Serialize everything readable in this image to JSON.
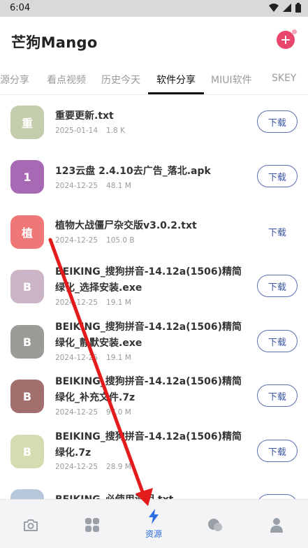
{
  "status": {
    "time": "6:04"
  },
  "app": {
    "title": "芒狗Mango"
  },
  "tabs": [
    {
      "label": "资源分享"
    },
    {
      "label": "看点视频"
    },
    {
      "label": "历史今天"
    },
    {
      "label": "软件分享"
    },
    {
      "label": "MIUI软件"
    },
    {
      "label": "SKEY"
    }
  ],
  "files": [
    {
      "avatar": "重",
      "color": "#c4ccae",
      "name": "重要更新.txt",
      "date": "2025-01-14",
      "size": "1.8 K",
      "button": "下载"
    },
    {
      "avatar": "1",
      "color": "#a769b3",
      "name": "123云盘 2.4.10去广告_落北.apk",
      "date": "2024-12-25",
      "size": "48.1 M",
      "button": "下载"
    },
    {
      "avatar": "植",
      "color": "#f07777",
      "name": "植物大战僵尸杂交版v3.0.2.txt",
      "date": "2024-12-25",
      "size": "105.0 B",
      "button": "下载"
    },
    {
      "avatar": "B",
      "color": "#cbb4c6",
      "name": "BEIKING_搜狗拼音-14.12a(1506)精简绿化_选择安装.exe",
      "date": "2024-12-25",
      "size": "19.1 M",
      "button": "下载"
    },
    {
      "avatar": "B",
      "color": "#9a9b96",
      "name": "BEIKING_搜狗拼音-14.12a(1506)精简绿化_静默安装.exe",
      "date": "2024-12-25",
      "size": "19.1 M",
      "button": "下载"
    },
    {
      "avatar": "B",
      "color": "#a26f6e",
      "name": "BEIKING_搜狗拼音-14.12a(1506)精简绿化_补充文件.7z",
      "date": "2024-12-25",
      "size": "97.0 M",
      "button": "下载"
    },
    {
      "avatar": "B",
      "color": "#d6dcb2",
      "name": "BEIKING_搜狗拼音-14.12a(1506)精简绿化.7z",
      "date": "2024-12-25",
      "size": "28.9 M",
      "button": "下载"
    },
    {
      "avatar": "B",
      "color": "#b7c8dd",
      "name": "BEIKING_必使用说明.txt",
      "date": "",
      "size": "",
      "button": "下载"
    }
  ],
  "bottom_nav": [
    {
      "icon": "camera-icon",
      "label": ""
    },
    {
      "icon": "grid-icon",
      "label": ""
    },
    {
      "icon": "lightning-icon",
      "label": "资源"
    },
    {
      "icon": "chat-icon",
      "label": ""
    },
    {
      "icon": "profile-icon",
      "label": ""
    }
  ],
  "colors": {
    "accent": "#2c6de0",
    "add_button": "#e8476b",
    "annotation_arrow": "#e31b1b"
  }
}
